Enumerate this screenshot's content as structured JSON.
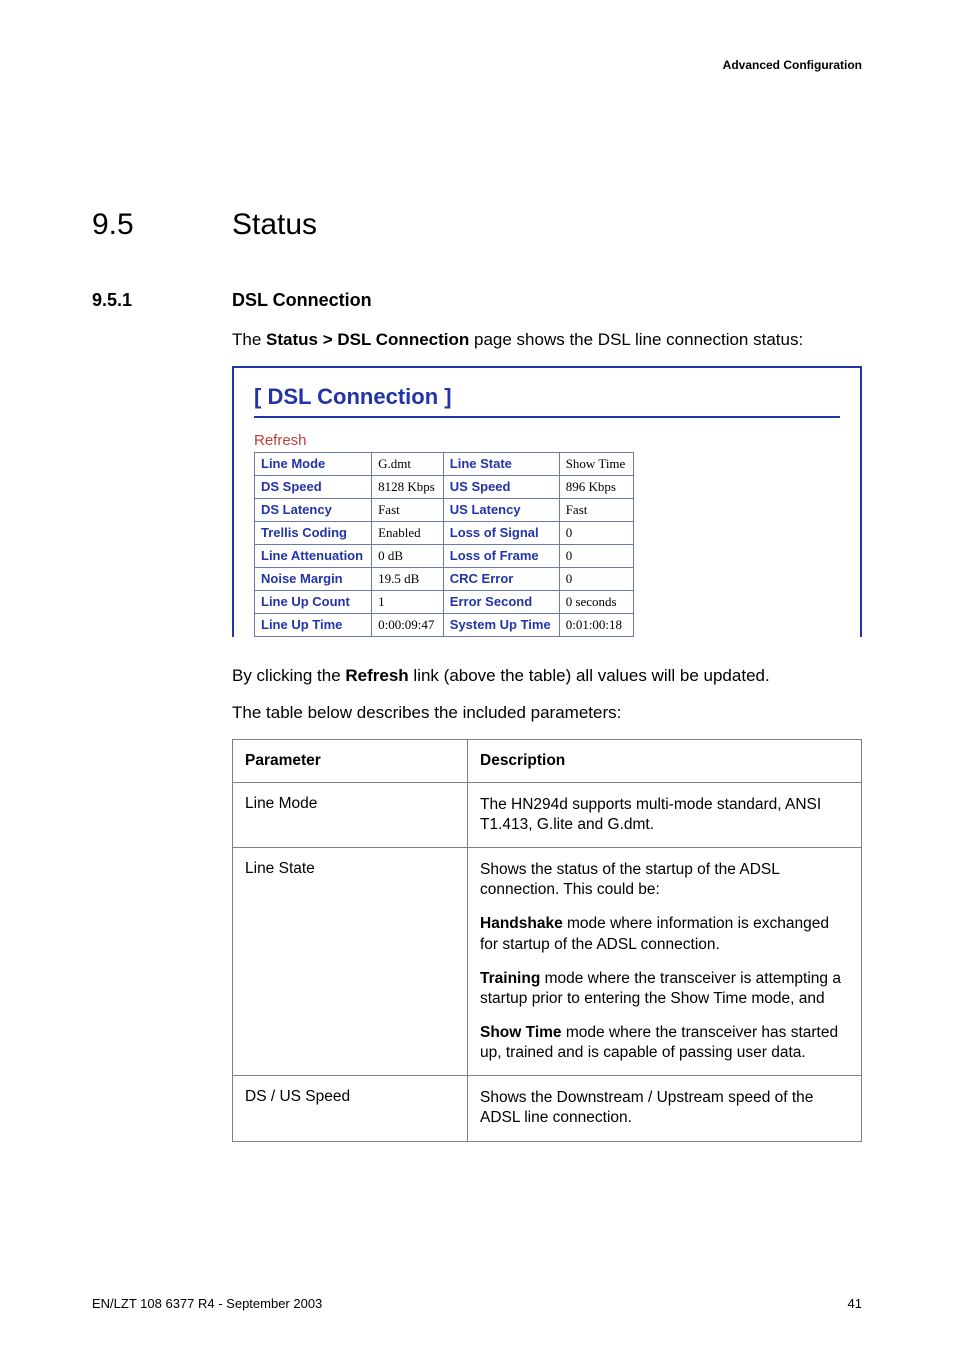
{
  "header": {
    "section": "Advanced Configuration"
  },
  "section": {
    "number": "9.5",
    "title": "Status",
    "sub_number": "9.5.1",
    "sub_title": "DSL Connection"
  },
  "intro": {
    "prefix": "The ",
    "path": "Status > DSL Connection",
    "suffix": " page shows the DSL line connection status:"
  },
  "screenshot": {
    "title": "[ DSL Connection ]",
    "refresh": "Refresh",
    "rows": [
      {
        "l1": "Line Mode",
        "v1": "G.dmt",
        "l2": "Line State",
        "v2": "Show Time"
      },
      {
        "l1": "DS Speed",
        "v1": "8128 Kbps",
        "l2": "US Speed",
        "v2": "896 Kbps"
      },
      {
        "l1": "DS Latency",
        "v1": "Fast",
        "l2": "US Latency",
        "v2": "Fast"
      },
      {
        "l1": "Trellis Coding",
        "v1": "Enabled",
        "l2": "Loss of Signal",
        "v2": "0"
      },
      {
        "l1": "Line Attenuation",
        "v1": "0 dB",
        "l2": "Loss of Frame",
        "v2": "0"
      },
      {
        "l1": "Noise Margin",
        "v1": "19.5 dB",
        "l2": "CRC Error",
        "v2": "0"
      },
      {
        "l1": "Line Up Count",
        "v1": "1",
        "l2": "Error Second",
        "v2": "0 seconds"
      },
      {
        "l1": "Line Up Time",
        "v1": "0:00:09:47",
        "l2": "System Up Time",
        "v2": "0:01:00:18"
      }
    ]
  },
  "after_shot": {
    "p1_a": "By clicking the ",
    "p1_b": "Refresh",
    "p1_c": " link (above the table) all values will be updated.",
    "p2": "The table below describes the included parameters:"
  },
  "params_table": {
    "header_param": "Parameter",
    "header_desc": "Description",
    "rows": {
      "line_mode": {
        "param": "Line Mode",
        "desc": "The HN294d supports multi-mode standard, ANSI T1.413, G.lite and G.dmt."
      },
      "line_state": {
        "param": "Line State",
        "intro": "Shows the status of the startup of the ADSL connection. This could be:",
        "hs_b": "Handshake",
        "hs_t": " mode where information is exchanged for startup of the ADSL connection.",
        "tr_b": "Training",
        "tr_t": " mode where the transceiver is attempting a startup prior to entering the Show Time mode, and",
        "st_b": "Show Time",
        "st_t": " mode where the transceiver has started up, trained and is capable of passing user data."
      },
      "speed": {
        "param": "DS / US Speed",
        "desc": "Shows the Downstream / Upstream speed of the ADSL line connection."
      }
    }
  },
  "footer": {
    "left": "EN/LZT 108 6377 R4 - September 2003",
    "right": "41"
  }
}
